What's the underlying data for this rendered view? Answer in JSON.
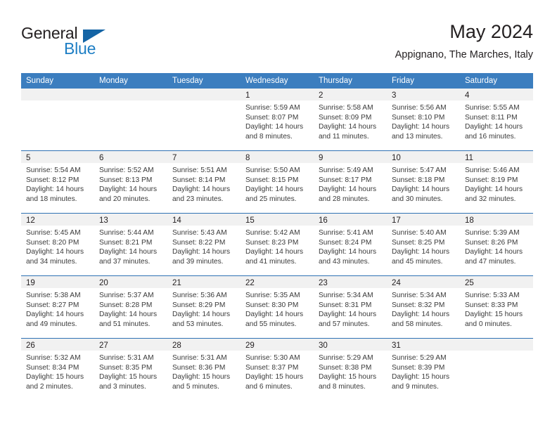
{
  "brand": {
    "word1": "General",
    "word2": "Blue",
    "logo_icon": "triangle-logo-icon",
    "accent_color": "#1d7ec4"
  },
  "header": {
    "title": "May 2024",
    "subtitle": "Appignano, The Marches, Italy"
  },
  "theme": {
    "header_blue": "#3c7ebf",
    "rule_blue": "#2f72b4",
    "band_gray": "#f1f1f1",
    "text": "#231f20"
  },
  "weekdays": [
    "Sunday",
    "Monday",
    "Tuesday",
    "Wednesday",
    "Thursday",
    "Friday",
    "Saturday"
  ],
  "weeks": [
    [
      {
        "day": "",
        "lines": []
      },
      {
        "day": "",
        "lines": []
      },
      {
        "day": "",
        "lines": []
      },
      {
        "day": "1",
        "lines": [
          "Sunrise: 5:59 AM",
          "Sunset: 8:07 PM",
          "Daylight: 14 hours",
          "and 8 minutes."
        ]
      },
      {
        "day": "2",
        "lines": [
          "Sunrise: 5:58 AM",
          "Sunset: 8:09 PM",
          "Daylight: 14 hours",
          "and 11 minutes."
        ]
      },
      {
        "day": "3",
        "lines": [
          "Sunrise: 5:56 AM",
          "Sunset: 8:10 PM",
          "Daylight: 14 hours",
          "and 13 minutes."
        ]
      },
      {
        "day": "4",
        "lines": [
          "Sunrise: 5:55 AM",
          "Sunset: 8:11 PM",
          "Daylight: 14 hours",
          "and 16 minutes."
        ]
      }
    ],
    [
      {
        "day": "5",
        "lines": [
          "Sunrise: 5:54 AM",
          "Sunset: 8:12 PM",
          "Daylight: 14 hours",
          "and 18 minutes."
        ]
      },
      {
        "day": "6",
        "lines": [
          "Sunrise: 5:52 AM",
          "Sunset: 8:13 PM",
          "Daylight: 14 hours",
          "and 20 minutes."
        ]
      },
      {
        "day": "7",
        "lines": [
          "Sunrise: 5:51 AM",
          "Sunset: 8:14 PM",
          "Daylight: 14 hours",
          "and 23 minutes."
        ]
      },
      {
        "day": "8",
        "lines": [
          "Sunrise: 5:50 AM",
          "Sunset: 8:15 PM",
          "Daylight: 14 hours",
          "and 25 minutes."
        ]
      },
      {
        "day": "9",
        "lines": [
          "Sunrise: 5:49 AM",
          "Sunset: 8:17 PM",
          "Daylight: 14 hours",
          "and 28 minutes."
        ]
      },
      {
        "day": "10",
        "lines": [
          "Sunrise: 5:47 AM",
          "Sunset: 8:18 PM",
          "Daylight: 14 hours",
          "and 30 minutes."
        ]
      },
      {
        "day": "11",
        "lines": [
          "Sunrise: 5:46 AM",
          "Sunset: 8:19 PM",
          "Daylight: 14 hours",
          "and 32 minutes."
        ]
      }
    ],
    [
      {
        "day": "12",
        "lines": [
          "Sunrise: 5:45 AM",
          "Sunset: 8:20 PM",
          "Daylight: 14 hours",
          "and 34 minutes."
        ]
      },
      {
        "day": "13",
        "lines": [
          "Sunrise: 5:44 AM",
          "Sunset: 8:21 PM",
          "Daylight: 14 hours",
          "and 37 minutes."
        ]
      },
      {
        "day": "14",
        "lines": [
          "Sunrise: 5:43 AM",
          "Sunset: 8:22 PM",
          "Daylight: 14 hours",
          "and 39 minutes."
        ]
      },
      {
        "day": "15",
        "lines": [
          "Sunrise: 5:42 AM",
          "Sunset: 8:23 PM",
          "Daylight: 14 hours",
          "and 41 minutes."
        ]
      },
      {
        "day": "16",
        "lines": [
          "Sunrise: 5:41 AM",
          "Sunset: 8:24 PM",
          "Daylight: 14 hours",
          "and 43 minutes."
        ]
      },
      {
        "day": "17",
        "lines": [
          "Sunrise: 5:40 AM",
          "Sunset: 8:25 PM",
          "Daylight: 14 hours",
          "and 45 minutes."
        ]
      },
      {
        "day": "18",
        "lines": [
          "Sunrise: 5:39 AM",
          "Sunset: 8:26 PM",
          "Daylight: 14 hours",
          "and 47 minutes."
        ]
      }
    ],
    [
      {
        "day": "19",
        "lines": [
          "Sunrise: 5:38 AM",
          "Sunset: 8:27 PM",
          "Daylight: 14 hours",
          "and 49 minutes."
        ]
      },
      {
        "day": "20",
        "lines": [
          "Sunrise: 5:37 AM",
          "Sunset: 8:28 PM",
          "Daylight: 14 hours",
          "and 51 minutes."
        ]
      },
      {
        "day": "21",
        "lines": [
          "Sunrise: 5:36 AM",
          "Sunset: 8:29 PM",
          "Daylight: 14 hours",
          "and 53 minutes."
        ]
      },
      {
        "day": "22",
        "lines": [
          "Sunrise: 5:35 AM",
          "Sunset: 8:30 PM",
          "Daylight: 14 hours",
          "and 55 minutes."
        ]
      },
      {
        "day": "23",
        "lines": [
          "Sunrise: 5:34 AM",
          "Sunset: 8:31 PM",
          "Daylight: 14 hours",
          "and 57 minutes."
        ]
      },
      {
        "day": "24",
        "lines": [
          "Sunrise: 5:34 AM",
          "Sunset: 8:32 PM",
          "Daylight: 14 hours",
          "and 58 minutes."
        ]
      },
      {
        "day": "25",
        "lines": [
          "Sunrise: 5:33 AM",
          "Sunset: 8:33 PM",
          "Daylight: 15 hours",
          "and 0 minutes."
        ]
      }
    ],
    [
      {
        "day": "26",
        "lines": [
          "Sunrise: 5:32 AM",
          "Sunset: 8:34 PM",
          "Daylight: 15 hours",
          "and 2 minutes."
        ]
      },
      {
        "day": "27",
        "lines": [
          "Sunrise: 5:31 AM",
          "Sunset: 8:35 PM",
          "Daylight: 15 hours",
          "and 3 minutes."
        ]
      },
      {
        "day": "28",
        "lines": [
          "Sunrise: 5:31 AM",
          "Sunset: 8:36 PM",
          "Daylight: 15 hours",
          "and 5 minutes."
        ]
      },
      {
        "day": "29",
        "lines": [
          "Sunrise: 5:30 AM",
          "Sunset: 8:37 PM",
          "Daylight: 15 hours",
          "and 6 minutes."
        ]
      },
      {
        "day": "30",
        "lines": [
          "Sunrise: 5:29 AM",
          "Sunset: 8:38 PM",
          "Daylight: 15 hours",
          "and 8 minutes."
        ]
      },
      {
        "day": "31",
        "lines": [
          "Sunrise: 5:29 AM",
          "Sunset: 8:39 PM",
          "Daylight: 15 hours",
          "and 9 minutes."
        ]
      },
      {
        "day": "",
        "lines": []
      }
    ]
  ]
}
